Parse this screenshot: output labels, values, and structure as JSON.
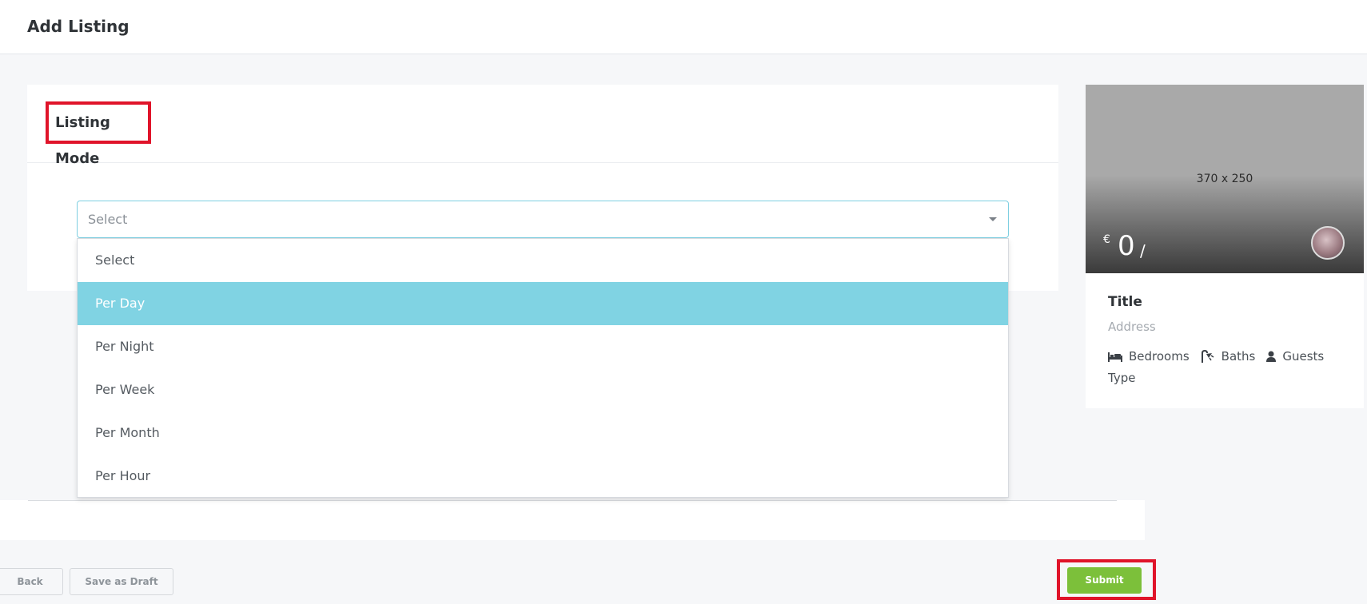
{
  "header": {
    "title": "Add Listing"
  },
  "listing_mode": {
    "section_title": "Listing Mode",
    "select": {
      "value": "Select",
      "options": [
        "Select",
        "Per Day",
        "Per Night",
        "Per Week",
        "Per Month",
        "Per Hour"
      ],
      "highlighted": "Per Day"
    }
  },
  "preview": {
    "image_placeholder": "370 x 250",
    "currency": "€",
    "price": "0",
    "per": "/",
    "title": "Title",
    "address": "Address",
    "meta": {
      "bedrooms": "Bedrooms",
      "baths": "Baths",
      "guests": "Guests",
      "type": "Type"
    },
    "icons": [
      "bed-icon",
      "shower-icon",
      "user-icon"
    ]
  },
  "footer": {
    "back_label": "Back",
    "draft_label": "Save as Draft",
    "submit_label": "Submit"
  },
  "colors": {
    "accent": "#80d3e3",
    "submit": "#7cc03a",
    "highlight_box": "#e0142a"
  }
}
